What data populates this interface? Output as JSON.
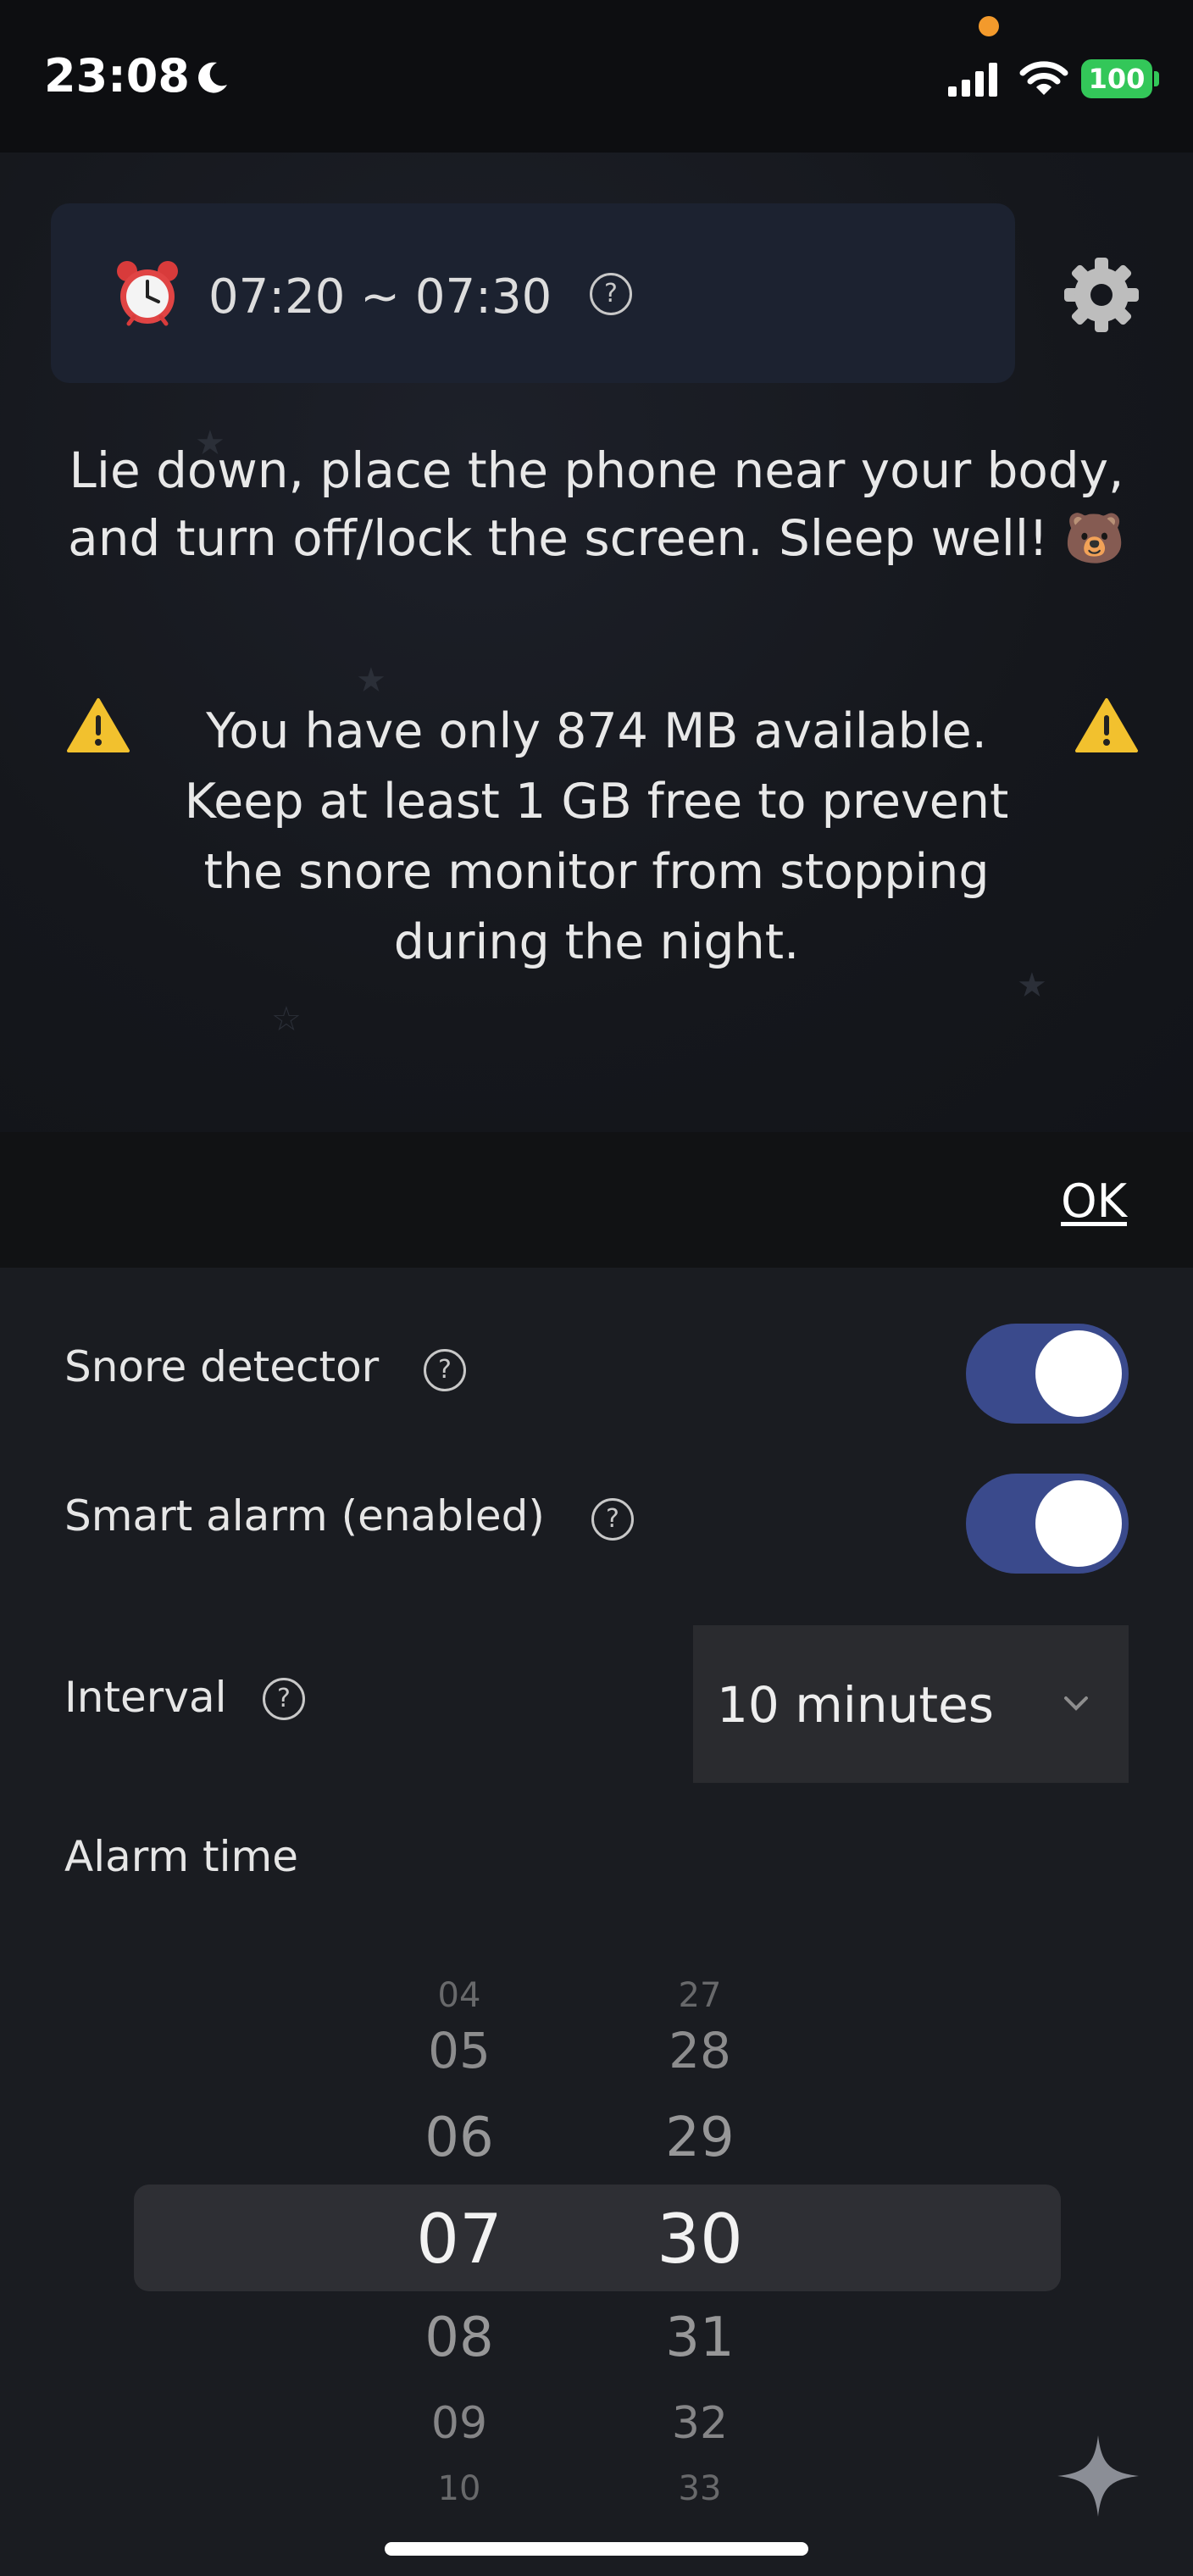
{
  "status_bar": {
    "time": "23:08",
    "battery": "100"
  },
  "alarm_window": {
    "range": "07:20 ~ 07:30",
    "help": "?"
  },
  "instructions": "Lie down, place the phone near your body, and turn off/lock the screen. Sleep well! 🐻",
  "warning": "You have only 874 MB available. Keep at least 1 GB free to prevent the snore monitor from stopping during the night.",
  "toolbar": {
    "ok_label": "OK"
  },
  "settings": {
    "snore_detector": {
      "label": "Snore detector",
      "help": "?",
      "enabled": true
    },
    "smart_alarm": {
      "label": "Smart alarm (enabled)",
      "help": "?",
      "enabled": true
    },
    "interval": {
      "label": "Interval",
      "help": "?",
      "value": "10 minutes"
    },
    "alarm_time_label": "Alarm time"
  },
  "time_picker": {
    "hours": [
      "04",
      "05",
      "06",
      "07",
      "08",
      "09",
      "10"
    ],
    "minutes": [
      "27",
      "28",
      "29",
      "30",
      "31",
      "32",
      "33"
    ],
    "selected_hour": "07",
    "selected_minute": "30"
  },
  "colors": {
    "accent_toggle": "#3a4a8c",
    "battery": "#33c759",
    "warning": "#f2c12e",
    "orange_dot": "#f39a2c"
  }
}
